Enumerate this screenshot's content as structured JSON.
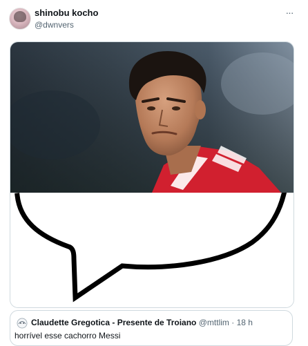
{
  "post": {
    "display_name": "shinobu kocho",
    "handle": "@dwnvers",
    "more_icon": "more-horizontal-icon",
    "more_glyph": "···"
  },
  "media": {
    "photo_icon": "photo-soccer-player",
    "overlay_icon": "speech-bubble-drawing"
  },
  "quoted_post": {
    "display_name": "Claudette Gregotica - Presente de Troiano",
    "handle": "@mttlim",
    "separator": "·",
    "time": "18 h",
    "text": "horrível esse cachorro Messi",
    "avatar_icon": "sketch-avatar-icon"
  },
  "colors": {
    "text_primary": "#0f1419",
    "text_secondary": "#536471",
    "border": "#cfd9de",
    "jersey_red": "#d1202f"
  }
}
